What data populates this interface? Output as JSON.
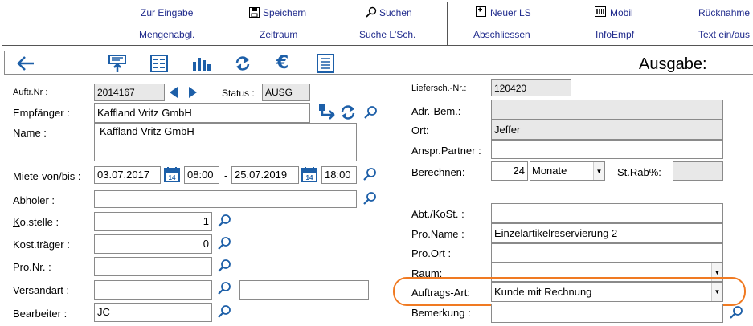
{
  "toolbar": {
    "zur_eingabe": "Zur Eingabe",
    "speichern": "Speichern",
    "suchen": "Suchen",
    "mengenabgl": "Mengenabgl.",
    "zeitraum": "Zeitraum",
    "suche_lsch": "Suche L'Sch.",
    "neuer_ls": "Neuer LS",
    "mobil": "Mobil",
    "ruecknahme": "Rücknahme",
    "abschliessen": "Abschliessen",
    "infoempf": "InfoEmpf",
    "text_ein_aus": "Text ein/aus"
  },
  "header": {
    "title": "Ausgabe:"
  },
  "left": {
    "auftr_nr_label": "Auftr.Nr :",
    "auftr_nr_value": "2014167",
    "status_label": "Status :",
    "status_value": "AUSG",
    "empfaenger_label": "Empfänger :",
    "empfaenger_value": "Kaffland Vritz GmbH",
    "name_label": "Name :",
    "name_value": "Kaffland Vritz GmbH",
    "miete_label": "Miete-von/bis :",
    "date_from": "03.07.2017",
    "time_from": "08:00",
    "date_sep": "-",
    "date_to": "25.07.2019",
    "time_to": "18:00",
    "cal_day": "14",
    "abholer_label": "Abholer :",
    "abholer_value": "",
    "kostelle_label_k": "K",
    "kostelle_label_rest": "o.stelle :",
    "kostelle_value": "1",
    "kosttraeger_label": "Kost.träger :",
    "kosttraeger_value": "0",
    "pronr_label": "Pro.Nr. :",
    "pronr_value": "",
    "versandart_label": "Versandart :",
    "versandart_value": "",
    "versandart_extra": "",
    "bearbeiter_label": "Bearbeiter :",
    "bearbeiter_value": "JC"
  },
  "right": {
    "liefersch_label": "Liefersch.-Nr.:",
    "liefersch_value": "120420",
    "adr_bem_label": "Adr.-Bem.:",
    "adr_bem_value": "",
    "ort_label": "Ort:",
    "ort_value": "Jeffer",
    "anspr_label": "Anspr.Partner :",
    "anspr_value": "",
    "berechnen_label_pre": "Be",
    "berechnen_label_r": "r",
    "berechnen_label_post": "echnen:",
    "berechnen_value": "24",
    "berechnen_unit": "Monate",
    "strab_label": "St.Rab%:",
    "strab_value": "",
    "abt_label": "Abt./KoSt. :",
    "abt_value": "",
    "proname_label": "Pro.Name :",
    "proname_value": "Einzelartikelreservierung 2",
    "proort_label": "Pro.Ort :",
    "proort_value": "",
    "raum_label": "Raum:",
    "raum_value": "",
    "auftragsart_label": "Auftrags-Art:",
    "auftragsart_value": "Kunde mit Rechnung",
    "bemerkung_label": "Bemerkung :",
    "bemerkung_value": ""
  },
  "colors": {
    "toolbar_text": "#1f2a8c",
    "icon_blue": "#1d5fa8",
    "highlight": "#f07a22"
  }
}
